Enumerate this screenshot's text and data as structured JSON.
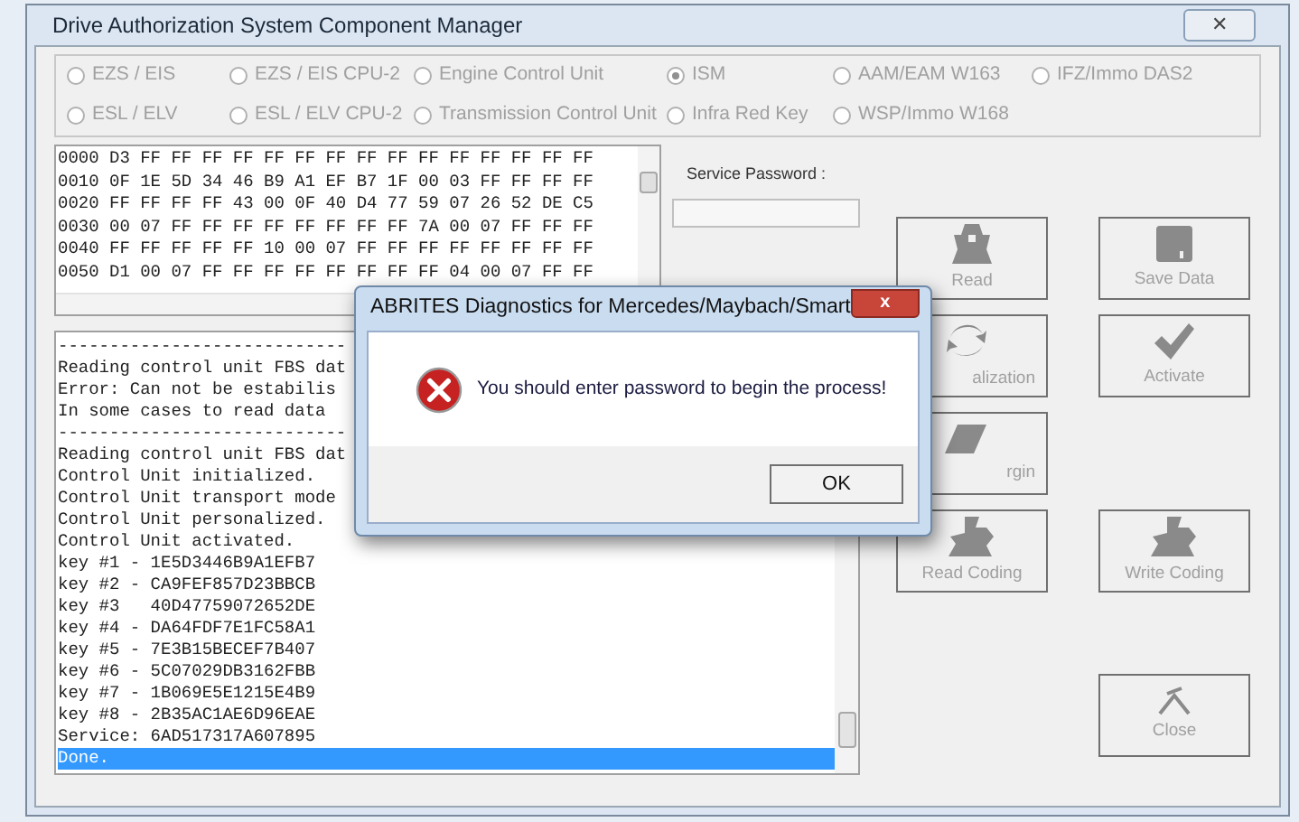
{
  "window": {
    "title": "Drive Authorization System Component Manager",
    "close": "✕"
  },
  "units": [
    {
      "label": "EZS / EIS",
      "selected": false
    },
    {
      "label": "EZS / EIS CPU-2",
      "selected": false
    },
    {
      "label": "Engine Control Unit",
      "selected": false
    },
    {
      "label": "ISM",
      "selected": true
    },
    {
      "label": "AAM/EAM W163",
      "selected": false
    },
    {
      "label": "IFZ/Immo DAS2",
      "selected": false
    },
    {
      "label": "ESL / ELV",
      "selected": false
    },
    {
      "label": "ESL / ELV CPU-2",
      "selected": false
    },
    {
      "label": "Transmission Control Unit",
      "selected": false
    },
    {
      "label": "Infra Red Key",
      "selected": false
    },
    {
      "label": "WSP/Immo W168",
      "selected": false
    }
  ],
  "hex_rows": [
    "0000 D3 FF FF FF FF FF FF FF FF FF FF FF FF FF FF FF",
    "0010 0F 1E 5D 34 46 B9 A1 EF B7 1F 00 03 FF FF FF FF",
    "0020 FF FF FF FF 43 00 0F 40 D4 77 59 07 26 52 DE C5",
    "0030 00 07 FF FF FF FF FF FF FF FF 7A 00 07 FF FF FF",
    "0040 FF FF FF FF FF 10 00 07 FF FF FF FF FF FF FF FF",
    "0050 D1 00 07 FF FF FF FF FF FF FF FF 04 00 07 FF FF"
  ],
  "service_password": {
    "label": "Service Password :"
  },
  "log": [
    {
      "text": "----------------------------",
      "selected": false
    },
    {
      "text": "Reading control unit FBS dat",
      "selected": false
    },
    {
      "text": "Error: Can not be estabilis",
      "selected": false
    },
    {
      "text": "In some cases to read data",
      "selected": false
    },
    {
      "text": "----------------------------",
      "selected": false
    },
    {
      "text": "Reading control unit FBS dat",
      "selected": false
    },
    {
      "text": "Control Unit initialized.",
      "selected": false
    },
    {
      "text": "Control Unit transport mode",
      "selected": false
    },
    {
      "text": "Control Unit personalized.",
      "selected": false
    },
    {
      "text": "Control Unit activated.",
      "selected": false
    },
    {
      "text": "key #1 - 1E5D3446B9A1EFB7",
      "selected": false
    },
    {
      "text": "key #2 - CA9FEF857D23BBCB",
      "selected": false
    },
    {
      "text": "key #3   40D47759072652DE",
      "selected": false
    },
    {
      "text": "key #4 - DA64FDF7E1FC58A1",
      "selected": false
    },
    {
      "text": "key #5 - 7E3B15BECEF7B407",
      "selected": false
    },
    {
      "text": "key #6 - 5C07029DB3162FBB",
      "selected": false
    },
    {
      "text": "key #7 - 1B069E5E1215E4B9",
      "selected": false
    },
    {
      "text": "key #8 - 2B35AC1AE6D96EAE",
      "selected": false
    },
    {
      "text": "Service: 6AD517317A607895",
      "selected": false
    },
    {
      "text": "Done.",
      "selected": true
    }
  ],
  "actions": [
    {
      "kind": "read",
      "label": "Read"
    },
    {
      "kind": "save",
      "label": "Save Data"
    },
    {
      "kind": "personalize",
      "label": "alization"
    },
    {
      "kind": "activate",
      "label": "Activate"
    },
    {
      "kind": "virgin",
      "label": "rgin"
    },
    {
      "kind": "none"
    },
    {
      "kind": "read_coding",
      "label": "Read Coding"
    },
    {
      "kind": "write_coding",
      "label": "Write Coding"
    }
  ],
  "close_button": {
    "label": "Close"
  },
  "dialog": {
    "title": "ABRITES Diagnostics for Mercedes/Maybach/Smart",
    "close": "x",
    "message": "You should enter password to begin the process!",
    "button": "OK"
  }
}
